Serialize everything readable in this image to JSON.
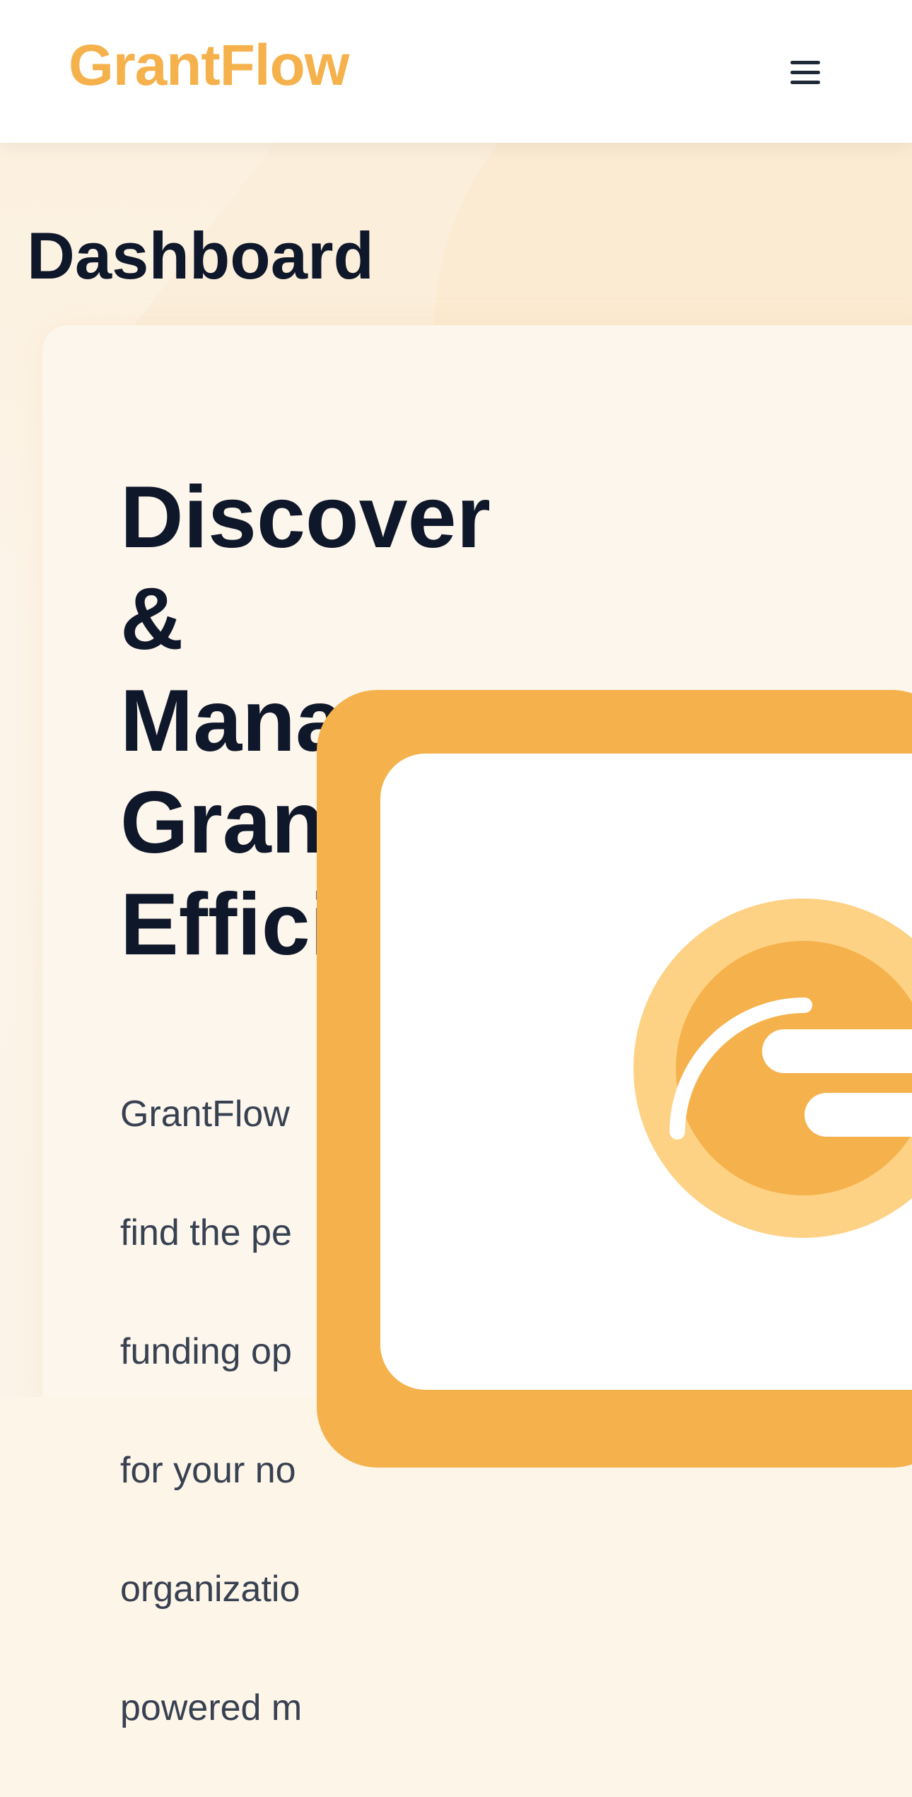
{
  "header": {
    "logo": "GrantFlow",
    "menu_icon": "hamburger-menu-icon"
  },
  "page": {
    "title": "Dashboard"
  },
  "hero": {
    "heading_lines": [
      "Discover",
      "&",
      "Mana",
      "Gran",
      "Effici"
    ],
    "description_lines": [
      "GrantFlow",
      "find the pe",
      "funding op",
      "for your no",
      "organizatio",
      "powered m"
    ]
  },
  "illustration": {
    "name": "grant-discovery-illustration",
    "colors": {
      "frame": "#f5b14c",
      "screen": "#ffffff",
      "outer_circle": "#fdd284",
      "inner_circle": "#f5b14c",
      "accent": "#ffffff"
    }
  },
  "colors": {
    "brand": "#f5b14c",
    "heading": "#0f172a",
    "body_text": "#374151",
    "background": "#fdf5e8"
  }
}
